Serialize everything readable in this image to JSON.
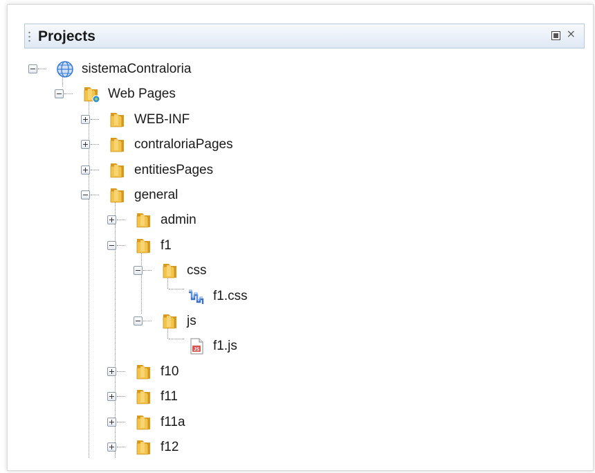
{
  "panel": {
    "title": "Projects",
    "minimize_icon": "minimize-window-icon",
    "close_icon": "close-icon",
    "close_glyph": "⨯"
  },
  "tree": {
    "nodes": [
      {
        "label": "sistemaContraloria",
        "icon": "globe-project-icon",
        "expander": "minus"
      },
      {
        "label": "Web Pages",
        "icon": "web-pages-folder-icon",
        "expander": "minus"
      },
      {
        "label": "WEB-INF",
        "icon": "folder-icon",
        "expander": "plus"
      },
      {
        "label": "contraloriaPages",
        "icon": "folder-icon",
        "expander": "plus"
      },
      {
        "label": "entitiesPages",
        "icon": "folder-icon",
        "expander": "plus"
      },
      {
        "label": "general",
        "icon": "folder-icon",
        "expander": "minus"
      },
      {
        "label": "admin",
        "icon": "folder-icon",
        "expander": "plus"
      },
      {
        "label": "f1",
        "icon": "folder-icon",
        "expander": "minus"
      },
      {
        "label": "css",
        "icon": "folder-icon",
        "expander": "minus"
      },
      {
        "label": "f1.css",
        "icon": "css-file-icon",
        "expander": "none"
      },
      {
        "label": "js",
        "icon": "folder-icon",
        "expander": "minus"
      },
      {
        "label": "f1.js",
        "icon": "js-file-icon",
        "expander": "none"
      },
      {
        "label": "f10",
        "icon": "folder-icon",
        "expander": "plus"
      },
      {
        "label": "f11",
        "icon": "folder-icon",
        "expander": "plus"
      },
      {
        "label": "f11a",
        "icon": "folder-icon",
        "expander": "plus"
      },
      {
        "label": "f12",
        "icon": "folder-icon",
        "expander": "plus"
      }
    ]
  },
  "colors": {
    "folder": "#f3c44a",
    "folder_dark": "#d99a1c",
    "header_border": "#b7c8dd",
    "globe": "#3a7bd5"
  }
}
